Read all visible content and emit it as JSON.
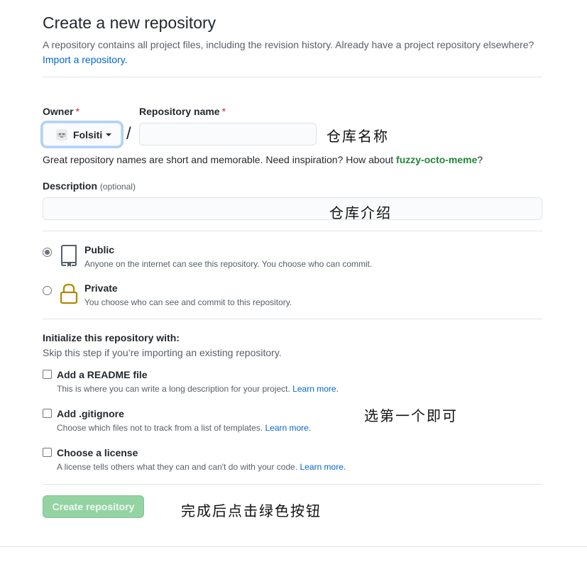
{
  "header": {
    "title": "Create a new repository",
    "lead": "A repository contains all project files, including the revision history. Already have a project repository elsewhere?",
    "import_link": "Import a repository."
  },
  "owner": {
    "label": "Owner",
    "required_mark": "*",
    "value": "Folsiti"
  },
  "repo_name": {
    "label": "Repository name",
    "required_mark": "*",
    "value": "",
    "separator": "/",
    "annotation": "仓库名称"
  },
  "hint": {
    "prefix": "Great repository names are short and memorable. Need inspiration? How about",
    "suggestion": "fuzzy-octo-meme",
    "suffix": "?"
  },
  "description": {
    "label": "Description",
    "optional": "(optional)",
    "value": "",
    "annotation": "仓库介绍"
  },
  "visibility": {
    "public": {
      "title": "Public",
      "desc": "Anyone on the internet can see this repository. You choose who can commit.",
      "selected": true
    },
    "private": {
      "title": "Private",
      "desc": "You choose who can see and commit to this repository.",
      "selected": false
    }
  },
  "init": {
    "title": "Initialize this repository with:",
    "subtitle": "Skip this step if you’re importing an existing repository.",
    "annotation": "选第一个即可",
    "learn_more": "Learn more.",
    "readme": {
      "title": "Add a README file",
      "desc": "This is where you can write a long description for your project.",
      "checked": false
    },
    "gitignore": {
      "title": "Add .gitignore",
      "desc": "Choose which files not to track from a list of templates.",
      "checked": false
    },
    "license": {
      "title": "Choose a license",
      "desc": "A license tells others what they can and can't do with your code.",
      "checked": false
    }
  },
  "submit": {
    "label": "Create repository",
    "annotation": "完成后点击绿色按钮"
  },
  "colors": {
    "link": "#0366d6",
    "suggestion": "#22863a",
    "required": "#cb2431",
    "button_disabled": "#94d3a2",
    "private_lock": "#b08800"
  },
  "icons": {
    "public": "repo-book-icon",
    "private": "lock-icon",
    "owner": "owner-avatar-icon"
  }
}
